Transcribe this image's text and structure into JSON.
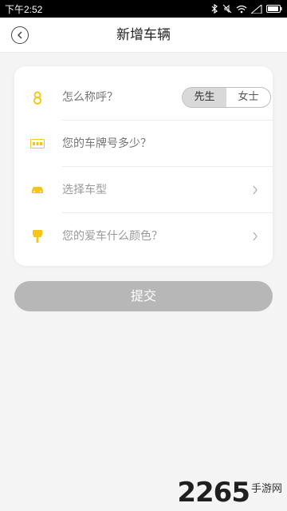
{
  "status": {
    "time": "下午2:52"
  },
  "header": {
    "title": "新增车辆"
  },
  "form": {
    "name_label": "怎么称呼？",
    "gender_options": [
      "先生",
      "女士"
    ],
    "gender_selected": "先生",
    "plate_label": "您的车牌号多少？",
    "model_label": "选择车型",
    "color_label": "您的爱车什么颜色？"
  },
  "submit": {
    "label": "提交"
  },
  "watermark": {
    "number": "2265",
    "text": "手游网"
  },
  "colors": {
    "accent": "#f5c518",
    "submit_bg": "#b7b7b7"
  }
}
